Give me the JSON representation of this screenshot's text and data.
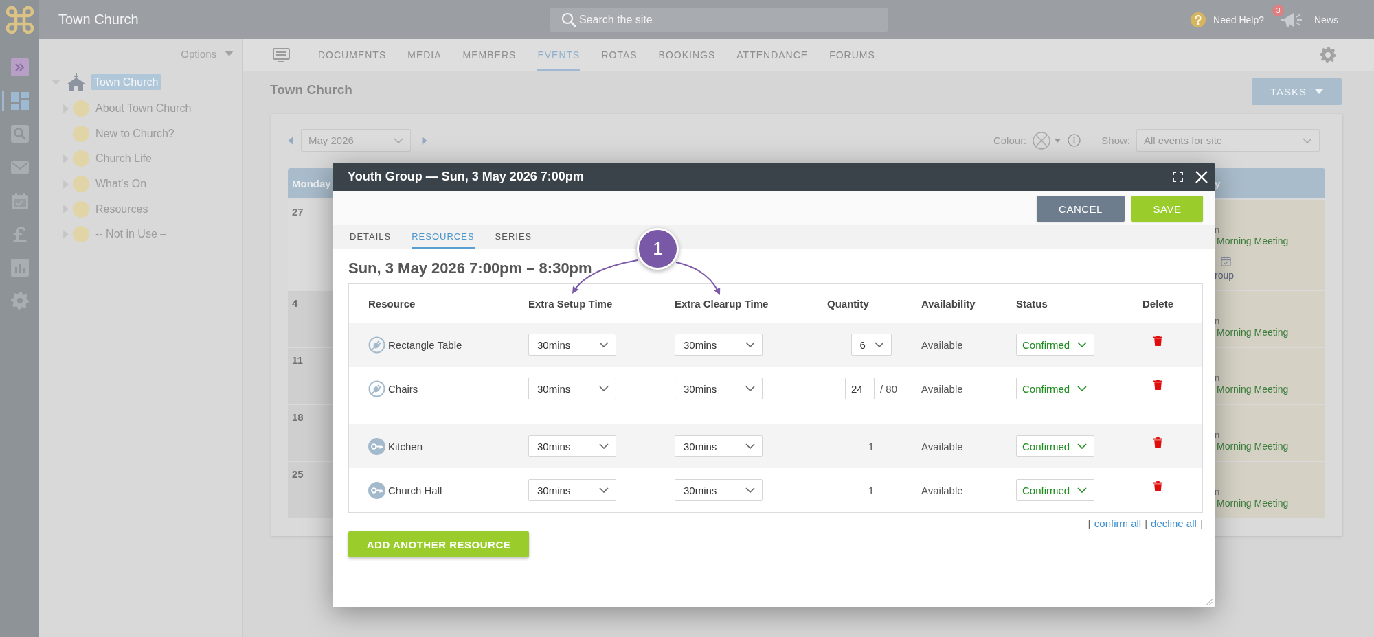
{
  "topbar": {
    "site_name": "Town Church",
    "search": {
      "placeholder": "Search the site"
    },
    "help": "Need Help?",
    "news": {
      "label": "News",
      "badge": "3"
    }
  },
  "rail": {
    "items": [
      {
        "kind": "expand",
        "selected": false
      },
      {
        "kind": "dashboard",
        "selected": true
      },
      {
        "kind": "search",
        "selected": false
      },
      {
        "kind": "mail",
        "selected": false
      },
      {
        "kind": "calendar",
        "selected": false
      },
      {
        "kind": "finance",
        "selected": false
      },
      {
        "kind": "reports",
        "selected": false
      },
      {
        "kind": "settings",
        "selected": false
      }
    ]
  },
  "tree": {
    "options": "Options",
    "root": {
      "label": "Town Church",
      "selected": true,
      "expanded": true,
      "children": [
        {
          "label": "About Town Church",
          "selected": false,
          "has_children": true,
          "expanded": false
        },
        {
          "label": "New to Church?",
          "selected": false,
          "has_children": false,
          "expanded": false
        },
        {
          "label": "Church Life",
          "selected": false,
          "has_children": true,
          "expanded": false
        },
        {
          "label": "What's On",
          "selected": false,
          "has_children": true,
          "expanded": false
        },
        {
          "label": "Resources",
          "selected": false,
          "has_children": true,
          "expanded": false
        },
        {
          "label": "-- Not in Use –",
          "selected": false,
          "has_children": true,
          "expanded": false
        }
      ]
    }
  },
  "nav": {
    "tabs": [
      {
        "label": "DOCUMENTS",
        "selected": false
      },
      {
        "label": "MEDIA",
        "selected": false
      },
      {
        "label": "MEMBERS",
        "selected": false
      },
      {
        "label": "EVENTS",
        "selected": true
      },
      {
        "label": "ROTAS",
        "selected": false
      },
      {
        "label": "BOOKINGS",
        "selected": false
      },
      {
        "label": "ATTENDANCE",
        "selected": false
      },
      {
        "label": "FORUMS",
        "selected": false
      }
    ]
  },
  "page": {
    "title": "Town Church",
    "tasks_button": "TASKS"
  },
  "calendar": {
    "month": "May 2026",
    "colour_label": "Colour:",
    "show_label": "Show:",
    "show_value": "All events for site",
    "day_headers": [
      "Monday",
      "y"
    ],
    "weeks": [
      {
        "first_day": {
          "date": "27",
          "other_month": true
        },
        "last_day": {
          "events": [
            {
              "kind": "plain",
              "time": "n",
              "title": "Morning Meeting"
            },
            {
              "kind": "booking",
              "title": "roup"
            }
          ]
        }
      },
      {
        "first_day": {
          "date": "4",
          "other_month": false
        },
        "last_day": {
          "events": [
            {
              "kind": "plain",
              "time": "n",
              "title": "Morning Meeting"
            }
          ]
        }
      },
      {
        "first_day": {
          "date": "11",
          "other_month": false
        },
        "last_day": {
          "events": [
            {
              "kind": "plain",
              "time": "n",
              "title": "Morning Meeting"
            }
          ]
        }
      },
      {
        "first_day": {
          "date": "18",
          "other_month": false
        },
        "last_day": {
          "events": [
            {
              "kind": "plain",
              "time": "n",
              "title": "Morning Meeting"
            }
          ]
        }
      },
      {
        "first_day": {
          "date": "25",
          "other_month": false
        },
        "last_day": {
          "events": [
            {
              "kind": "plain",
              "time": "n",
              "title": "Morning Meeting"
            }
          ]
        }
      }
    ]
  },
  "modal": {
    "title": "Youth Group — Sun, 3 May 2026 7:00pm",
    "buttons": [
      {
        "kind": "secondary",
        "label": "CANCEL"
      },
      {
        "kind": "primary",
        "label": "SAVE"
      }
    ],
    "tabs": [
      {
        "label": "DETAILS",
        "selected": false
      },
      {
        "label": "RESOURCES",
        "selected": true
      },
      {
        "label": "SERIES",
        "selected": false
      }
    ],
    "heading": "Sun, 3 May 2026 7:00pm – 8:30pm",
    "table": {
      "columns": [
        "Resource",
        "Extra Setup Time",
        "Extra Clearup Time",
        "Quantity",
        "Availability",
        "Status",
        "Delete"
      ],
      "rows": [
        {
          "kind": "equipment",
          "name": "Rectangle Table",
          "setup": "30mins",
          "clearup": "30mins",
          "quantity": {
            "kind": "select",
            "value": "6"
          },
          "availability": "Available",
          "status": "Confirmed"
        },
        {
          "kind": "equipment",
          "name": "Chairs",
          "setup": "30mins",
          "clearup": "30mins",
          "quantity": {
            "kind": "input",
            "value": "24",
            "max": "/ 80"
          },
          "availability": "Available",
          "status": "Confirmed"
        },
        {
          "kind": "room",
          "name": "Kitchen",
          "setup": "30mins",
          "clearup": "30mins",
          "quantity": {
            "kind": "text",
            "value": "1"
          },
          "availability": "Available",
          "status": "Confirmed"
        },
        {
          "kind": "room",
          "name": "Church Hall",
          "setup": "30mins",
          "clearup": "30mins",
          "quantity": {
            "kind": "text",
            "value": "1"
          },
          "availability": "Available",
          "status": "Confirmed"
        }
      ]
    },
    "bulk_actions": {
      "open": "[",
      "links": [
        "confirm all",
        "decline all"
      ],
      "separator": "|",
      "close": "]"
    },
    "add_button": "ADD ANOTHER RESOURCE"
  },
  "callout": {
    "number": "1"
  }
}
